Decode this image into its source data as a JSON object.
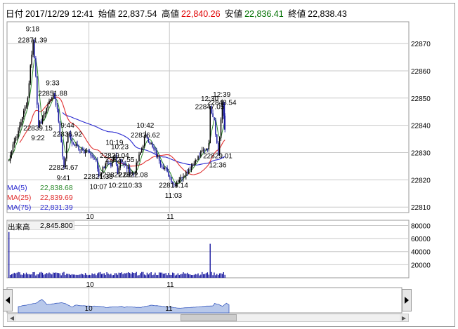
{
  "header": {
    "date_label": "日付",
    "datetime": "2017/12/29 12:41",
    "open_label": "始値",
    "open": "22,837.54",
    "high_label": "高値",
    "high": "22,840.26",
    "low_label": "安値",
    "low": "22,836.41",
    "close_label": "終値",
    "close": "22,838.43"
  },
  "colors": {
    "up": "#000000",
    "down": "#1a1aa0",
    "ma5": "#2e8b2e",
    "ma25": "#e03030",
    "ma75": "#2a2ad0",
    "vol": "#1a1aa0",
    "grid": "#c8c8c8",
    "high_red": "#e00000",
    "low_green": "#007000"
  },
  "price_axis": {
    "ticks": [
      "22870",
      "22860",
      "22850",
      "22840",
      "22830",
      "22820",
      "22810"
    ]
  },
  "volume_axis": {
    "ticks": [
      "80000",
      "60000",
      "40000",
      "20000"
    ]
  },
  "time_axis": {
    "labels": [
      "10",
      "11"
    ]
  },
  "annotations": [
    {
      "text": "9:18",
      "x": "9:18",
      "y": 22875.6
    },
    {
      "text": "22871.39",
      "x": "9:18",
      "y": 22871.39
    },
    {
      "text": "9:33",
      "x": "9:33",
      "y": 22855.7
    },
    {
      "text": "22851.88",
      "x": "9:33",
      "y": 22851.88
    },
    {
      "text": "22839.15",
      "x": "9:22",
      "y": 22839.15
    },
    {
      "text": "9:22",
      "x": "9:22",
      "y": 22835.5
    },
    {
      "text": "9:44",
      "x": "9:44",
      "y": 22840.2
    },
    {
      "text": "22836.92",
      "x": "9:44",
      "y": 22836.92
    },
    {
      "text": "22824.67",
      "x": "9:41",
      "y": 22824.67
    },
    {
      "text": "9:41",
      "x": "9:41",
      "y": 22820.9
    },
    {
      "text": "10:42",
      "x": "10:42",
      "y": 22840.2
    },
    {
      "text": "22836.62",
      "x": "10:42",
      "y": 22836.62
    },
    {
      "text": "10:19",
      "x": "10:19",
      "y": 22833.8
    },
    {
      "text": "10:23",
      "x": "10:23",
      "y": 22832.3
    },
    {
      "text": "22829.04",
      "x": "10:19",
      "y": 22829.04
    },
    {
      "text": "22827.55",
      "x": "10:23",
      "y": 22827.55
    },
    {
      "text": "22822.08",
      "x": "10:33",
      "y": 22822.08
    },
    {
      "text": "22822.08",
      "x": "10:21",
      "y": 22822.08
    },
    {
      "text": "22821.38",
      "x": "10:07",
      "y": 22821.38
    },
    {
      "text": "10:07",
      "x": "10:07",
      "y": 22817.6
    },
    {
      "text": "10:21",
      "x": "10:21",
      "y": 22818.2
    },
    {
      "text": "10:33",
      "x": "10:33",
      "y": 22818.2
    },
    {
      "text": "22818.14",
      "x": "11:03",
      "y": 22818.14
    },
    {
      "text": "11:03",
      "x": "11:03",
      "y": 22814.4
    },
    {
      "text": "12:39",
      "x": "12:39",
      "y": 22851.5
    },
    {
      "text": "12:30",
      "x": "12:30",
      "y": 22849.9
    },
    {
      "text": "22848.54",
      "x": "12:39",
      "y": 22848.54
    },
    {
      "text": "22847.05",
      "x": "12:30",
      "y": 22847.05
    },
    {
      "text": "22829.01",
      "x": "12:36",
      "y": 22829.01
    },
    {
      "text": "12:36",
      "x": "12:36",
      "y": 22825.6
    }
  ],
  "legend": {
    "ma5_label": "MA(5)",
    "ma5_value": "22,838.68",
    "ma25_label": "MA(25)",
    "ma25_value": "22,839.69",
    "ma75_label": "MA(75)",
    "ma75_value": "22,831.39"
  },
  "volume_panel": {
    "label": "出来高",
    "value": "2,845.800"
  },
  "overview": {
    "labels": [
      "10",
      "11"
    ]
  },
  "chart_data": {
    "type": "candlestick",
    "interval": "1 minute",
    "date": "2017/12/29",
    "x_ticks": [
      "10:00",
      "11:00"
    ],
    "ylim": [
      22808,
      22878
    ],
    "y_ticks": [
      22870,
      22860,
      22850,
      22840,
      22830,
      22820,
      22810
    ],
    "key_points": [
      {
        "time": "9:00",
        "price": 22827
      },
      {
        "time": "9:03",
        "price": 22833
      },
      {
        "time": "9:07",
        "price": 22838
      },
      {
        "time": "9:10",
        "price": 22843
      },
      {
        "time": "9:14",
        "price": 22850
      },
      {
        "time": "9:16",
        "price": 22862
      },
      {
        "time": "9:18",
        "price": 22871.39
      },
      {
        "time": "9:20",
        "price": 22858
      },
      {
        "time": "9:22",
        "price": 22839.15
      },
      {
        "time": "9:26",
        "price": 22844
      },
      {
        "time": "9:30",
        "price": 22849
      },
      {
        "time": "9:33",
        "price": 22851.88
      },
      {
        "time": "9:36",
        "price": 22846
      },
      {
        "time": "9:41",
        "price": 22824.67
      },
      {
        "time": "9:44",
        "price": 22836.92
      },
      {
        "time": "9:48",
        "price": 22833
      },
      {
        "time": "9:55",
        "price": 22831
      },
      {
        "time": "10:00",
        "price": 22830
      },
      {
        "time": "10:05",
        "price": 22827
      },
      {
        "time": "10:07",
        "price": 22821.38
      },
      {
        "time": "10:12",
        "price": 22826
      },
      {
        "time": "10:16",
        "price": 22825
      },
      {
        "time": "10:19",
        "price": 22829.04
      },
      {
        "time": "10:21",
        "price": 22822.08
      },
      {
        "time": "10:23",
        "price": 22827.55
      },
      {
        "time": "10:28",
        "price": 22824
      },
      {
        "time": "10:33",
        "price": 22822.08
      },
      {
        "time": "10:38",
        "price": 22830
      },
      {
        "time": "10:42",
        "price": 22836.62
      },
      {
        "time": "10:47",
        "price": 22832
      },
      {
        "time": "10:52",
        "price": 22827
      },
      {
        "time": "10:58",
        "price": 22823
      },
      {
        "time": "11:03",
        "price": 22818.14
      },
      {
        "time": "11:08",
        "price": 22821
      },
      {
        "time": "11:12",
        "price": 22823
      },
      {
        "time": "11:18",
        "price": 22826
      },
      {
        "time": "11:25",
        "price": 22831
      },
      {
        "time": "11:30",
        "price": 22833
      },
      {
        "time": "12:30",
        "price": 22847.05
      },
      {
        "time": "12:33",
        "price": 22842
      },
      {
        "time": "12:36",
        "price": 22829.01
      },
      {
        "time": "12:39",
        "price": 22848.54
      },
      {
        "time": "12:41",
        "price": 22838.43
      }
    ],
    "volume": {
      "ylim": [
        0,
        88000
      ],
      "spike": {
        "time": "12:30",
        "value": 52000
      },
      "typical": 6000,
      "last": 2845.8
    },
    "moving_averages": {
      "MA(5)": 22838.68,
      "MA(25)": 22839.69,
      "MA(75)": 22831.39
    }
  }
}
